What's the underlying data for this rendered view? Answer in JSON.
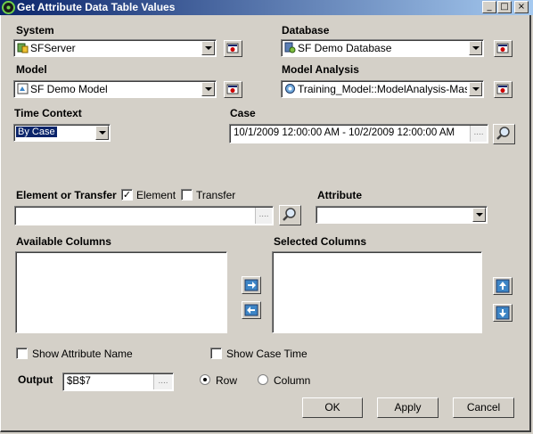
{
  "window": {
    "title": "Get Attribute Data Table Values",
    "minimize_glyph": "_",
    "maximize_glyph": "□",
    "close_glyph": "×"
  },
  "system": {
    "label": "System",
    "value": "SFServer",
    "icon": "server-icon"
  },
  "database": {
    "label": "Database",
    "value": "SF Demo Database",
    "icon": "database-icon"
  },
  "model": {
    "label": "Model",
    "value": "SF Demo Model",
    "icon": "model-icon"
  },
  "model_analysis": {
    "label": "Model Analysis",
    "value": "Training_Model::ModelAnalysis-Mass",
    "icon": "analysis-icon"
  },
  "time_context": {
    "label": "Time Context",
    "value": "By Case"
  },
  "case": {
    "label": "Case",
    "value": "10/1/2009 12:00:00 AM - 10/2/2009 12:00:00 AM",
    "ellipsis": "...."
  },
  "element_or_transfer": {
    "label": "Element or Transfer",
    "element_label": "Element",
    "element_checked": true,
    "transfer_label": "Transfer",
    "transfer_checked": false,
    "value": "",
    "ellipsis": "...."
  },
  "attribute": {
    "label": "Attribute",
    "value": ""
  },
  "available_columns": {
    "label": "Available Columns",
    "items": []
  },
  "selected_columns": {
    "label": "Selected Columns",
    "items": []
  },
  "show_attribute_name": {
    "label": "Show Attribute Name",
    "checked": false
  },
  "show_case_time": {
    "label": "Show Case Time",
    "checked": false
  },
  "output": {
    "label": "Output",
    "value": "$B$7",
    "ellipsis": "...."
  },
  "orientation": {
    "row_label": "Row",
    "column_label": "Column",
    "selected": "Row"
  },
  "buttons": {
    "ok": "OK",
    "apply": "Apply",
    "cancel": "Cancel"
  },
  "colors": {
    "titlebar_start": "#0a246a",
    "titlebar_end": "#a6caf0",
    "selection": "#0a246a",
    "face": "#d4d0c8"
  }
}
